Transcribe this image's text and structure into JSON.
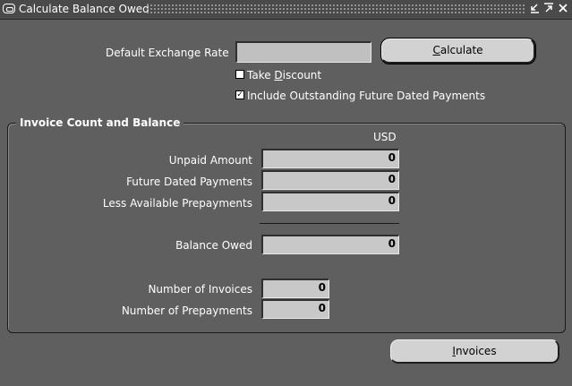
{
  "window": {
    "title": "Calculate Balance Owed",
    "minimize_icon": "minimize-icon",
    "maximize_icon": "maximize-icon",
    "close_icon": "close-icon"
  },
  "exchange": {
    "label": "Default Exchange Rate",
    "value": ""
  },
  "calculate_button": {
    "mnemonic": "C",
    "rest": "alculate"
  },
  "take_discount": {
    "checked": false,
    "pre": "Take ",
    "mnemonic": "D",
    "rest": "iscount"
  },
  "include_future": {
    "checked": true,
    "label": "Include Outstanding Future Dated Payments"
  },
  "group": {
    "title": "Invoice Count and Balance",
    "currency": "USD",
    "unpaid_label": "Unpaid Amount",
    "unpaid_value": "0",
    "future_label": "Future Dated Payments",
    "future_value": "0",
    "prepay_label": "Less Available Prepayments",
    "prepay_value": "0",
    "balance_label": "Balance Owed",
    "balance_value": "0",
    "num_invoices_label": "Number of Invoices",
    "num_invoices_value": "0",
    "num_prepayments_label": "Number of Prepayments",
    "num_prepayments_value": "0"
  },
  "invoices_button": {
    "mnemonic": "I",
    "rest": "nvoices"
  },
  "colors": {
    "background": "#5f5f5f",
    "field": "#c8c8c8",
    "button": "#d2d2d2"
  }
}
